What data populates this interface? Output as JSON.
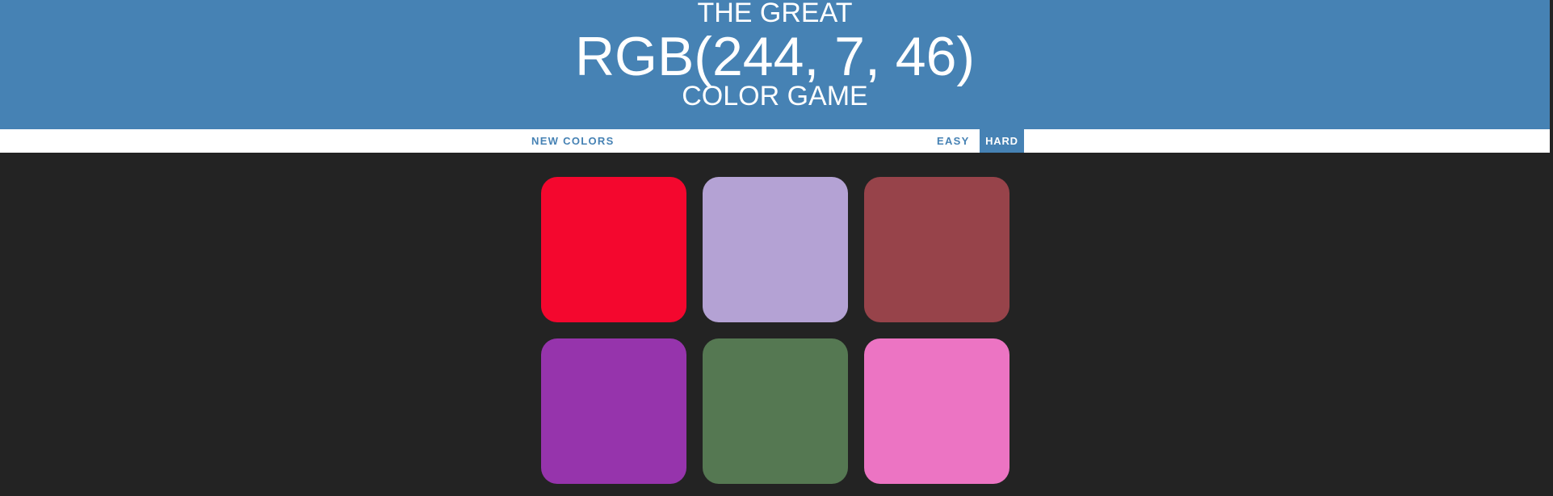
{
  "header": {
    "title_top": "THE GREAT",
    "rgb_display": "RGB(244, 7, 46)",
    "title_bottom": "COLOR GAME",
    "background": "#4682b4"
  },
  "stripe": {
    "new_colors_label": "NEW COLORS",
    "message": "",
    "modes": [
      {
        "label": "EASY",
        "selected": false
      },
      {
        "label": "HARD",
        "selected": true
      }
    ]
  },
  "game": {
    "target_color": "rgb(244, 7, 46)",
    "squares": [
      {
        "color": "#f4072e"
      },
      {
        "color": "#b4a2d4"
      },
      {
        "color": "#97434a"
      },
      {
        "color": "#9634ac"
      },
      {
        "color": "#557852"
      },
      {
        "color": "#ec74c3"
      }
    ]
  }
}
